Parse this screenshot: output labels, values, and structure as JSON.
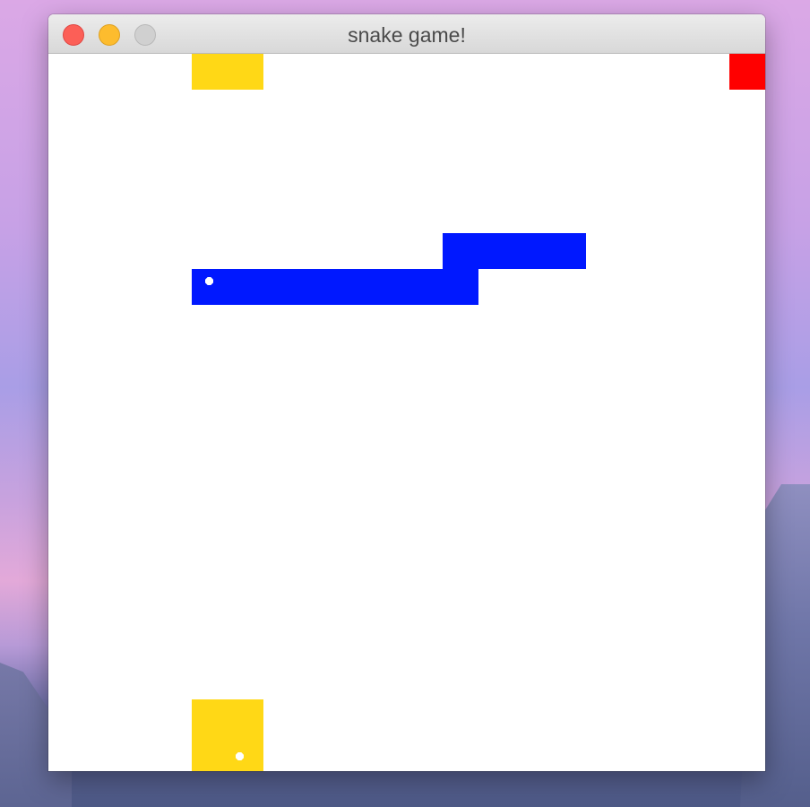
{
  "window": {
    "title": "snake game!",
    "buttons": {
      "close": "close",
      "minimize": "minimize",
      "zoom": "zoom"
    }
  },
  "colors": {
    "board": "#ffffff",
    "snake": "#0018ff",
    "obstacle": "#ffd816",
    "food": "#ff0000",
    "eye": "#ffffff"
  },
  "game": {
    "grid_columns": 20,
    "grid_rows": 20,
    "snake": {
      "color_key": "snake",
      "cells": [
        [
          4,
          6
        ],
        [
          5,
          6
        ],
        [
          6,
          6
        ],
        [
          7,
          6
        ],
        [
          8,
          6
        ],
        [
          9,
          6
        ],
        [
          10,
          6
        ],
        [
          11,
          6
        ],
        [
          11,
          5
        ],
        [
          12,
          5
        ],
        [
          13,
          5
        ],
        [
          14,
          5
        ]
      ],
      "head_cell": [
        4,
        6
      ]
    },
    "obstacles": [
      {
        "cells": [
          [
            4,
            0
          ],
          [
            5,
            0
          ]
        ]
      },
      {
        "cells": [
          [
            4,
            18
          ],
          [
            5,
            18
          ],
          [
            4,
            19
          ],
          [
            5,
            19
          ]
        ],
        "has_eye": true,
        "eye_cell": [
          5,
          19
        ]
      }
    ],
    "food": {
      "cells": [
        [
          19,
          0
        ]
      ]
    }
  }
}
